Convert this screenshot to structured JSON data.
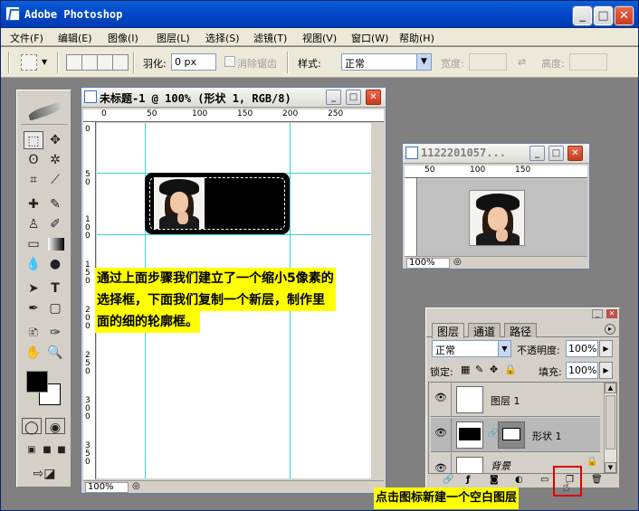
{
  "app": {
    "title": "Adobe Photoshop"
  },
  "window_buttons": {
    "minimize": "_",
    "maximize": "□",
    "close": "✕"
  },
  "menu": {
    "items": [
      "文件(F)",
      "编辑(E)",
      "图像(I)",
      "图层(L)",
      "选择(S)",
      "滤镜(T)",
      "视图(V)",
      "窗口(W)",
      "帮助(H)"
    ]
  },
  "options": {
    "feather_label": "羽化:",
    "feather_value": "0 px",
    "antialias_label": "消除锯齿",
    "style_label": "样式:",
    "style_value": "正常",
    "width_label": "宽度:",
    "height_label": "高度:"
  },
  "doc_main": {
    "title": "未标题-1 @ 100% (形状 1, RGB/8)",
    "zoom": "100%",
    "ruler_top": [
      "0",
      "50",
      "100",
      "150",
      "200",
      "250"
    ],
    "ruler_left": [
      "0",
      "5\n0",
      "1\n0\n0",
      "1\n5\n0",
      "2\n0\n0",
      "2\n5\n0",
      "3\n0\n0",
      "3\n5\n0"
    ]
  },
  "doc_small": {
    "title": "1122201057...",
    "zoom": "100%",
    "ruler_top": [
      "50",
      "100",
      "150"
    ]
  },
  "annotation": {
    "line1": "通过上面步骤我们建立了一个缩小5像素的",
    "line2": "选择框，下面我们复制一个新层，制作里",
    "line3": "面的细的轮廓框。"
  },
  "layers_panel": {
    "tabs": [
      "图层",
      "通道",
      "路径"
    ],
    "blend_mode": "正常",
    "opacity_label": "不透明度:",
    "opacity_value": "100%",
    "lock_label": "锁定:",
    "fill_label": "填充:",
    "fill_value": "100%",
    "layers": [
      {
        "name": "图层 1"
      },
      {
        "name": "形状 1"
      },
      {
        "name": "背景"
      }
    ]
  },
  "bottom_caption": "点击图标新建一个空白图层",
  "colors": {
    "titlebar": "#0046c8",
    "guide": "#40d0d0",
    "annotation_bg": "#ffff00",
    "highlight_box": "#e00000"
  }
}
